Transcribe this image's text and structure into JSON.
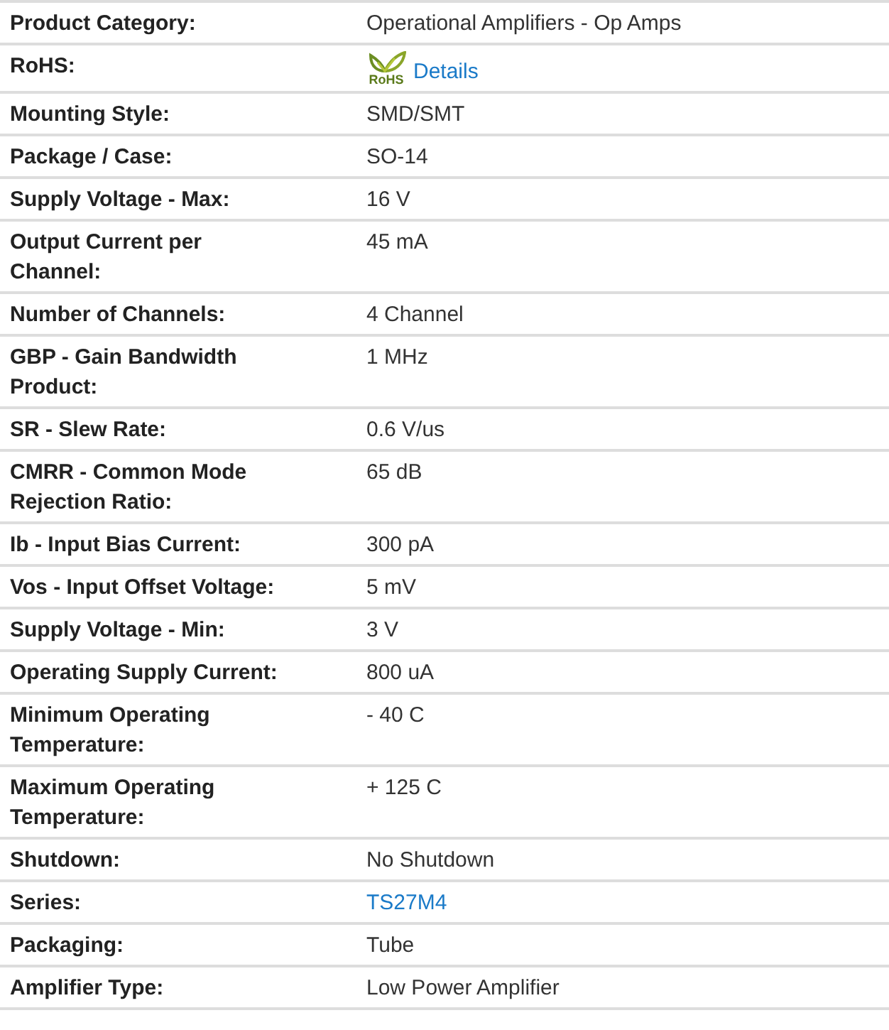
{
  "rows": [
    {
      "label": "Product Category:",
      "kind": "text",
      "value": "Operational Amplifiers - Op Amps"
    },
    {
      "label": "RoHS:",
      "kind": "rohs",
      "logo_text": "RoHS",
      "value": "Details"
    },
    {
      "label": "Mounting Style:",
      "kind": "text",
      "value": "SMD/SMT"
    },
    {
      "label": "Package / Case:",
      "kind": "text",
      "value": "SO-14"
    },
    {
      "label": "Supply Voltage - Max:",
      "kind": "text",
      "value": "16 V"
    },
    {
      "label": "Output Current per Channel:",
      "kind": "text",
      "value": "45 mA"
    },
    {
      "label": "Number of Channels:",
      "kind": "text",
      "value": "4 Channel"
    },
    {
      "label": "GBP - Gain Bandwidth Product:",
      "kind": "text",
      "value": "1 MHz"
    },
    {
      "label": "SR - Slew Rate:",
      "kind": "text",
      "value": "0.6 V/us"
    },
    {
      "label": "CMRR - Common Mode Rejection Ratio:",
      "kind": "text",
      "value": "65 dB"
    },
    {
      "label": "Ib - Input Bias Current:",
      "kind": "text",
      "value": "300 pA"
    },
    {
      "label": "Vos - Input Offset Voltage:",
      "kind": "text",
      "value": "5 mV"
    },
    {
      "label": "Supply Voltage - Min:",
      "kind": "text",
      "value": "3 V"
    },
    {
      "label": "Operating Supply Current:",
      "kind": "text",
      "value": "800 uA"
    },
    {
      "label": "Minimum Operating Temperature:",
      "kind": "text",
      "value": "- 40 C"
    },
    {
      "label": "Maximum Operating Temperature:",
      "kind": "text",
      "value": "+ 125 C"
    },
    {
      "label": "Shutdown:",
      "kind": "text",
      "value": "No Shutdown"
    },
    {
      "label": "Series:",
      "kind": "link",
      "value": "TS27M4"
    },
    {
      "label": "Packaging:",
      "kind": "text",
      "value": "Tube"
    },
    {
      "label": "Amplifier Type:",
      "kind": "text",
      "value": "Low Power Amplifier"
    }
  ]
}
